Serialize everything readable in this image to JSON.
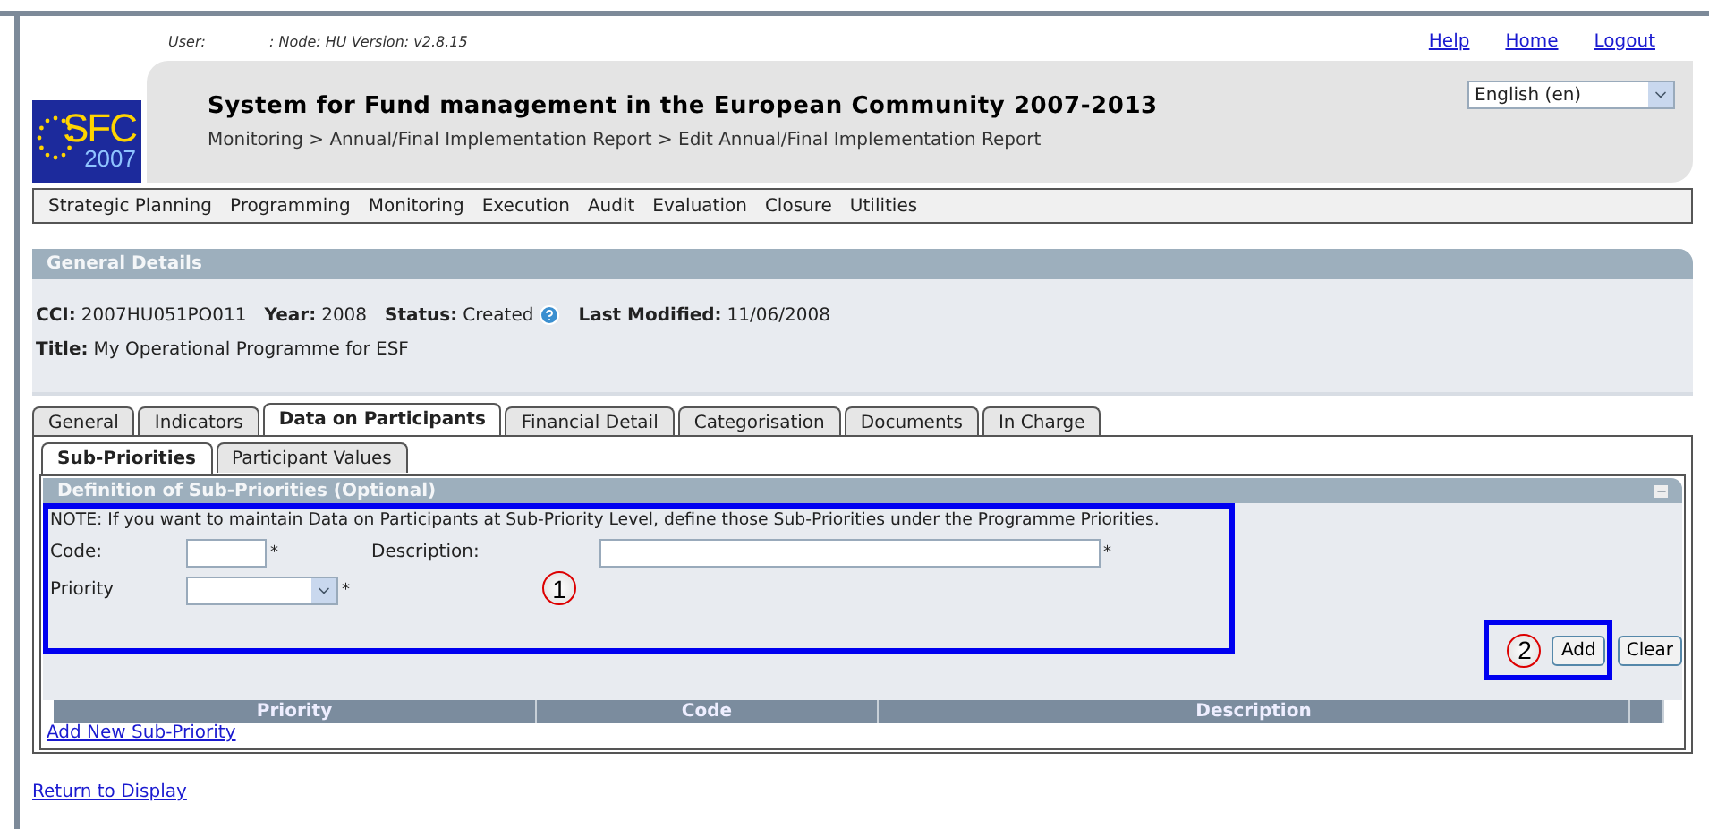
{
  "top_bar": {
    "user_label": "User:",
    "session_info": ": Node: HU   Version: v2.8.15",
    "links": [
      "Help",
      "Home",
      "Logout"
    ]
  },
  "logo": {
    "text": "SFC",
    "year": "2007"
  },
  "header": {
    "title": "System for Fund management in the European Community 2007-2013",
    "breadcrumb": "Monitoring > Annual/Final Implementation Report > Edit Annual/Final Implementation Report",
    "language": "English (en)"
  },
  "menu": [
    "Strategic Planning",
    "Programming",
    "Monitoring",
    "Execution",
    "Audit",
    "Evaluation",
    "Closure",
    "Utilities"
  ],
  "general_details": {
    "title": "General Details",
    "fields": [
      {
        "label": "CCI:",
        "value": "2007HU051PO011",
        "help": false
      },
      {
        "label": "Year:",
        "value": "2008",
        "help": false
      },
      {
        "label": "Status:",
        "value": "Created",
        "help": true
      },
      {
        "label": "Last Modified:",
        "value": "11/06/2008",
        "help": false
      }
    ],
    "title_field": {
      "label": "Title:",
      "value": "My Operational Programme for ESF"
    }
  },
  "tabs": [
    {
      "label": "General",
      "selected": false
    },
    {
      "label": "Indicators",
      "selected": false
    },
    {
      "label": "Data on Participants",
      "selected": true
    },
    {
      "label": "Financial Detail",
      "selected": false
    },
    {
      "label": "Categorisation",
      "selected": false
    },
    {
      "label": "Documents",
      "selected": false
    },
    {
      "label": "In Charge",
      "selected": false
    }
  ],
  "sub_tabs": [
    {
      "label": "Sub-Priorities",
      "selected": true
    },
    {
      "label": "Participant Values",
      "selected": false
    }
  ],
  "section": {
    "title": "Definition of Sub-Priorities (Optional)",
    "note": "NOTE: If you want to maintain Data on Participants at Sub-Priority Level, define those Sub-Priorities under the Programme Priorities.",
    "code": {
      "label": "Code:",
      "required": "*"
    },
    "description": {
      "label": "Description:",
      "required": "*"
    },
    "priority": {
      "label": "Priority",
      "required": "*"
    },
    "buttons": [
      "Add",
      "Clear"
    ],
    "callouts": [
      "1",
      "2"
    ]
  },
  "table": {
    "columns": [
      "Priority",
      "Code",
      "Description"
    ]
  },
  "add_link": "Add New Sub-Priority",
  "return_link": "Return to Display"
}
